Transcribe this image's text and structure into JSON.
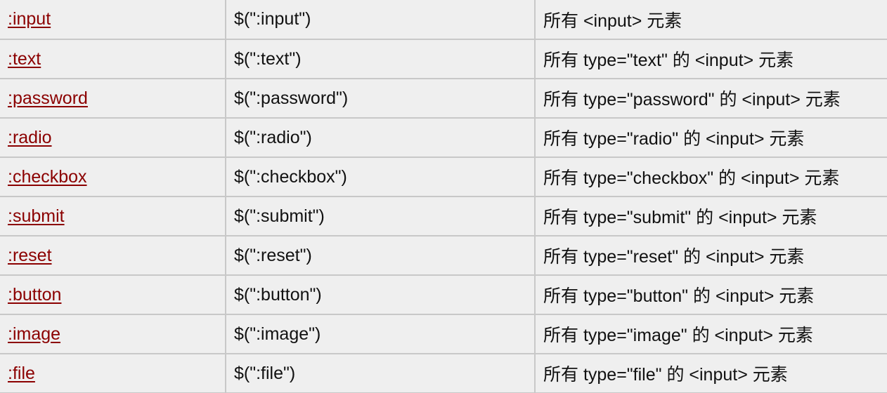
{
  "table": {
    "rows": [
      {
        "selector": ":input",
        "example": "$(\":input\")",
        "description": "所有 <input> 元素"
      },
      {
        "selector": ":text",
        "example": "$(\":text\")",
        "description": "所有 type=\"text\" 的 <input> 元素"
      },
      {
        "selector": ":password",
        "example": "$(\":password\")",
        "description": "所有 type=\"password\" 的 <input> 元素"
      },
      {
        "selector": ":radio",
        "example": "$(\":radio\")",
        "description": "所有 type=\"radio\" 的 <input> 元素"
      },
      {
        "selector": ":checkbox",
        "example": "$(\":checkbox\")",
        "description": "所有 type=\"checkbox\" 的 <input> 元素"
      },
      {
        "selector": ":submit",
        "example": "$(\":submit\")",
        "description": "所有 type=\"submit\" 的 <input> 元素"
      },
      {
        "selector": ":reset",
        "example": "$(\":reset\")",
        "description": "所有 type=\"reset\" 的 <input> 元素"
      },
      {
        "selector": ":button",
        "example": "$(\":button\")",
        "description": "所有 type=\"button\" 的 <input> 元素"
      },
      {
        "selector": ":image",
        "example": "$(\":image\")",
        "description": "所有 type=\"image\" 的 <input> 元素"
      },
      {
        "selector": ":file",
        "example": "$(\":file\")",
        "description": "所有 type=\"file\" 的 <input> 元素"
      }
    ]
  },
  "colors": {
    "link": "#8b0000",
    "background": "#efefef",
    "border": "#c8c8c8",
    "text": "#111111"
  }
}
